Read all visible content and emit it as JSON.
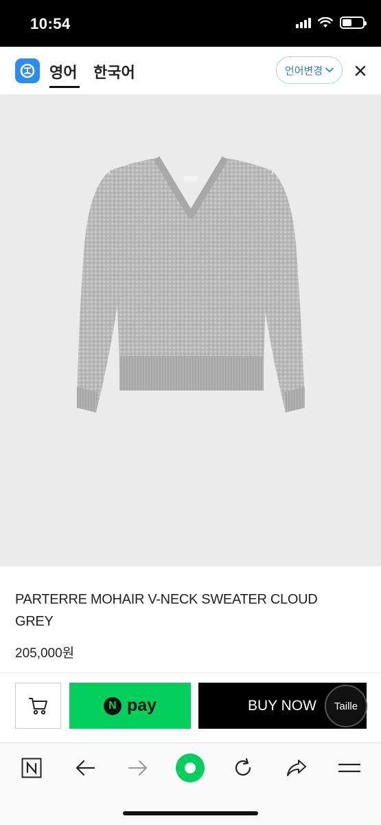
{
  "status_bar": {
    "time": "10:54",
    "signal_icon": "cellular-signal-icon",
    "wifi_icon": "wifi-icon",
    "battery_icon": "battery-icon"
  },
  "translation_header": {
    "logo_icon": "translate-app-logo-icon",
    "tabs": [
      {
        "label": "영어",
        "active": true
      },
      {
        "label": "한국어",
        "active": false
      }
    ],
    "change_language_label": "언어변경",
    "change_language_icon": "chevron-down-icon",
    "close_icon": "close-icon",
    "accent_color": "#2d7fc6"
  },
  "product": {
    "image_alt": "grey mohair v-neck sweater",
    "title": "PARTERRE MOHAIR V-NECK SWEATER CLOUD GREY",
    "price": "205,000원"
  },
  "purchase_bar": {
    "cart_icon": "cart-icon",
    "npay_logo_letter": "N",
    "npay_label": "pay",
    "npay_color": "#03cf5d",
    "buy_now_label": "BUY NOW",
    "brand_badge_label": "Taille"
  },
  "browser_toolbar": {
    "icons": [
      "naver-n-icon",
      "back-arrow-icon",
      "forward-arrow-icon",
      "green-home-dot-icon",
      "refresh-icon",
      "share-icon",
      "menu-icon"
    ]
  }
}
